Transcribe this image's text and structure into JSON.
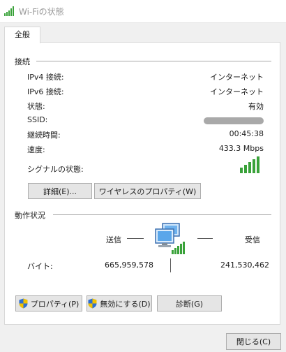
{
  "window": {
    "title": "Wi-Fiの状態"
  },
  "tabs": [
    {
      "label": "全般"
    }
  ],
  "connection": {
    "section_label": "接続",
    "rows": [
      {
        "label": "IPv4 接続:",
        "value": "インターネット"
      },
      {
        "label": "IPv6 接続:",
        "value": "インターネット"
      },
      {
        "label": "状態:",
        "value": "有効"
      },
      {
        "label": "SSID:",
        "value": ""
      },
      {
        "label": "継続時間:",
        "value": "00:45:38"
      },
      {
        "label": "速度:",
        "value": "433.3 Mbps"
      }
    ],
    "signal_label": "シグナルの状態:",
    "signal_bars": 5,
    "details_button": "詳細(E)...",
    "wireless_props_button": "ワイヤレスのプロパティ(W)"
  },
  "activity": {
    "section_label": "動作状況",
    "sent_label": "送信",
    "received_label": "受信",
    "bytes_label": "バイト:",
    "bytes_sent": "665,959,578",
    "bytes_received": "241,530,462"
  },
  "actions": {
    "properties_button": "プロパティ(P)",
    "disable_button": "無効にする(D)",
    "diagnose_button": "診断(G)"
  },
  "close_button": "閉じる(C)",
  "colors": {
    "signal_green": "#3aa23a",
    "shield_blue": "#2f6fd1",
    "shield_yellow": "#f2c200"
  }
}
